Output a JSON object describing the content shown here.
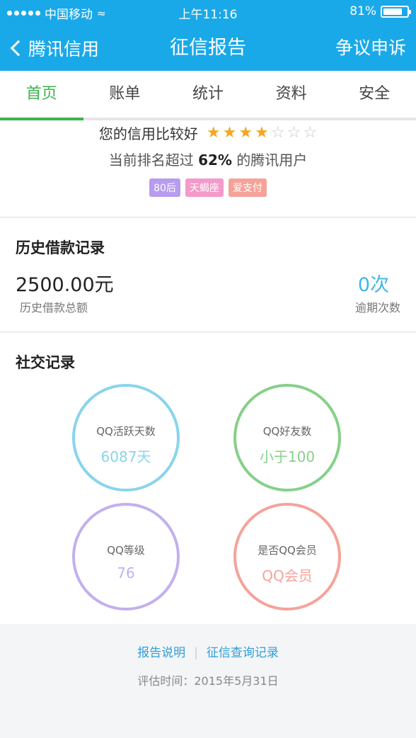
{
  "status_bar": {
    "carrier": "中国移动",
    "time": "上午11:16",
    "battery": "81%",
    "battery_level": 0.81
  },
  "nav": {
    "back_label": "腾讯信用",
    "title": "征信报告",
    "right_label": "争议申诉"
  },
  "tabs": [
    {
      "label": "首页",
      "active": true
    },
    {
      "label": "账单"
    },
    {
      "label": "统计"
    },
    {
      "label": "资料"
    },
    {
      "label": "安全"
    }
  ],
  "summary": {
    "rating_text": "您的信用比较好",
    "stars_filled": 4,
    "stars_total": 7,
    "rank_prefix": "当前排名超过",
    "rank_value": "62%",
    "rank_suffix": "的腾讯用户",
    "tags": [
      {
        "label": "80后",
        "color": "#b79cf0"
      },
      {
        "label": "天蝎座",
        "color": "#f49ac9"
      },
      {
        "label": "爱支付",
        "color": "#f5a39a"
      }
    ]
  },
  "history": {
    "title": "历史借款记录",
    "amount_value": "2500.00元",
    "amount_label": "历史借款总额",
    "overdue_value": "0次",
    "overdue_label": "逾期次数"
  },
  "social": {
    "title": "社交记录",
    "circles": [
      {
        "label": "QQ活跃天数",
        "value": "6087天",
        "color": "#8ad4ec"
      },
      {
        "label": "QQ好友数",
        "value": "小于100",
        "color": "#87d08a"
      },
      {
        "label": "QQ等级",
        "value": "76",
        "color": "#c3b0ee"
      },
      {
        "label": "是否QQ会员",
        "value": "QQ会员",
        "color": "#f5a39a"
      }
    ]
  },
  "footer": {
    "link_report": "报告说明",
    "link_query": "征信查询记录",
    "eval_time": "评估时间：2015年5月31日"
  }
}
